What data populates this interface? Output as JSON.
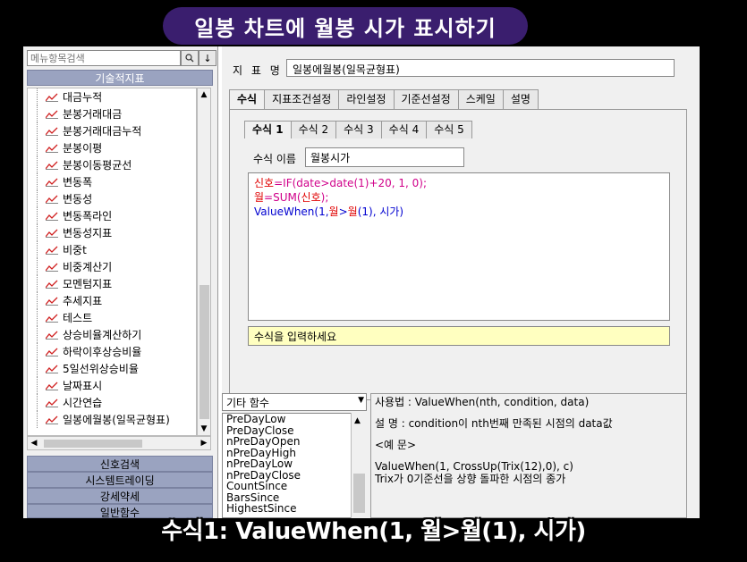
{
  "banner": {
    "title": "일봉 차트에 월봉 시가 표시하기"
  },
  "left": {
    "search_placeholder": "메뉴항목검색",
    "search_btn": "Q",
    "down_btn": "↓",
    "category_top": "기술적지표",
    "items": [
      "대금누적",
      "분봉거래대금",
      "분봉거래대금누적",
      "분봉이평",
      "분봉이동평균선",
      "변동폭",
      "변동성",
      "변동폭라인",
      "변동성지표",
      "비중t",
      "비중계산기",
      "모멘텀지표",
      "추세지표",
      "테스트",
      "상승비율계산하기",
      "하락이후상승비율",
      "5일선위상승비율",
      "날짜표시",
      "시간연습",
      "일봉에월봉(일목균형표)"
    ],
    "bottom_categories": [
      "신호검색",
      "시스템트레이딩",
      "강세약세",
      "일반함수"
    ]
  },
  "right": {
    "name_label": "지 표 명",
    "name_value": "일봉에월봉(일목균형표)",
    "tabs": [
      "수식",
      "지표조건설정",
      "라인설정",
      "기준선설정",
      "스케일",
      "설명"
    ],
    "subtabs": [
      "수식 1",
      "수식 2",
      "수식 3",
      "수식 4",
      "수식 5"
    ],
    "formula_name_label": "수식 이름",
    "formula_name_value": "월봉시가",
    "code": {
      "l1_a": "신호",
      "l1_b": "=IF(date>date(1)+20, 1, 0);",
      "l2_a": "월",
      "l2_b": "=SUM(",
      "l2_c": "신호",
      "l2_d": ");",
      "l3_a": "ValueWhen(1,",
      "l3_b": "월",
      "l3_c": ">",
      "l3_d": "월",
      "l3_e": "(1), 시가)"
    },
    "hint": "수식을 입력하세요",
    "func_category": "기타 함수",
    "func_list": [
      "PreDayLow",
      "PreDayClose",
      "nPreDayOpen",
      "nPreDayHigh",
      "nPreDayLow",
      "nPreDayClose",
      "CountSince",
      "BarsSince",
      "HighestSince"
    ],
    "help": {
      "usage": "사용법 : ValueWhen(nth, condition, data)",
      "desc": "설    명 : condition이 nth번째 만족된 시점의 data값",
      "example_label": "<예 문>",
      "example1": "ValueWhen(1, CrossUp(Trix(12),0), c)",
      "example2": "Trix가 0기준선을 상향 돌파한 시점의 종가"
    }
  },
  "subtitle": "수식1:  ValueWhen(1, 월>월(1), 시가)",
  "colors": {
    "banner": "#3a1e6e",
    "cat_header": "#9aa3c0",
    "hint_bg": "#ffffc0"
  }
}
